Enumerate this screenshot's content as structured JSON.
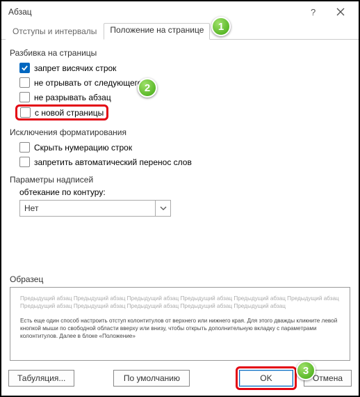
{
  "title": "Абзац",
  "tabs": {
    "indent": "Отступы и интервалы",
    "position": "Положение на странице"
  },
  "pagination": {
    "label": "Разбивка на страницы",
    "widow": "запрет висячих строк",
    "keep_next": "не отрывать от следующего",
    "keep_together": "не разрывать абзац",
    "page_break": "с новой страницы"
  },
  "exceptions": {
    "label": "Исключения форматирования",
    "suppress_lines": "Скрыть нумерацию строк",
    "no_hyphen": "запретить автоматический перенос слов"
  },
  "textbox": {
    "label": "Параметры надписей",
    "wrap_label": "обтекание по контуру:",
    "combo_value": "Нет"
  },
  "preview": {
    "label": "Образец",
    "ghost": "Предыдущий абзац Предыдущий абзац Предыдущий абзац Предыдущий абзац Предыдущий абзац Предыдущий абзац Предыдущий абзац Предыдущий абзац Предыдущий абзац Предыдущий абзац Предыдущий абзац",
    "body": "Есть еще один способ настроить отступ колонтитулов от верхнего или нижнего края. Для этого дважды кликните левой кнопкой мыши по свободной области вверху или внизу, чтобы открыть дополнительную вкладку с параметрами колонтитулов. Далее в блоке «Положение»"
  },
  "buttons": {
    "tabs": "Табуляция...",
    "default": "По умолчанию",
    "ok": "OK",
    "cancel": "Отмена"
  },
  "badges": {
    "b1": "1",
    "b2": "2",
    "b3": "3"
  }
}
